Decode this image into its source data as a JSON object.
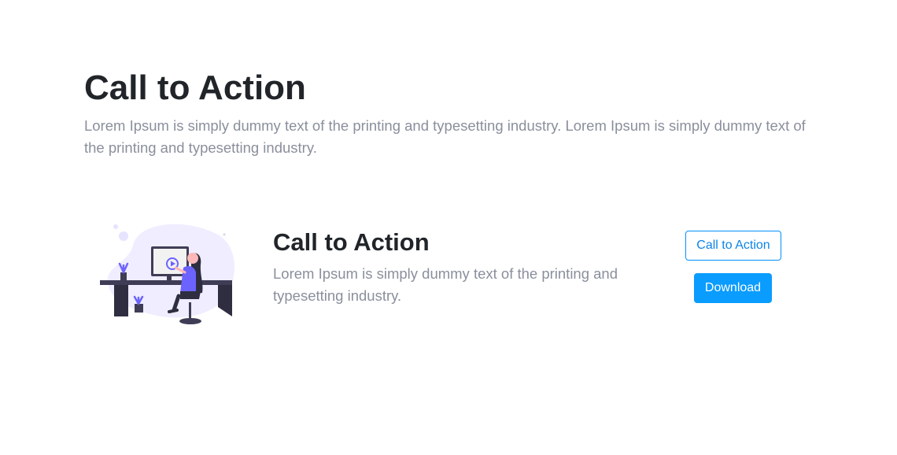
{
  "header": {
    "title": "Call to Action",
    "description": "Lorem Ipsum is simply dummy text of the printing and typesetting industry. Lorem Ipsum is simply dummy text of the printing and typesetting industry."
  },
  "cta": {
    "illustration_icon": "person-at-desk-watching-video-illustration",
    "title": "Call to Action",
    "description": "Lorem Ipsum is simply dummy text of the printing and typesetting industry.",
    "primary_outline_label": "Call to Action",
    "download_label": "Download"
  },
  "colors": {
    "accent": "#0a9cff",
    "illustration_purple": "#6c63ff",
    "illustration_dark": "#3f3d56",
    "blob": "#efedff"
  }
}
